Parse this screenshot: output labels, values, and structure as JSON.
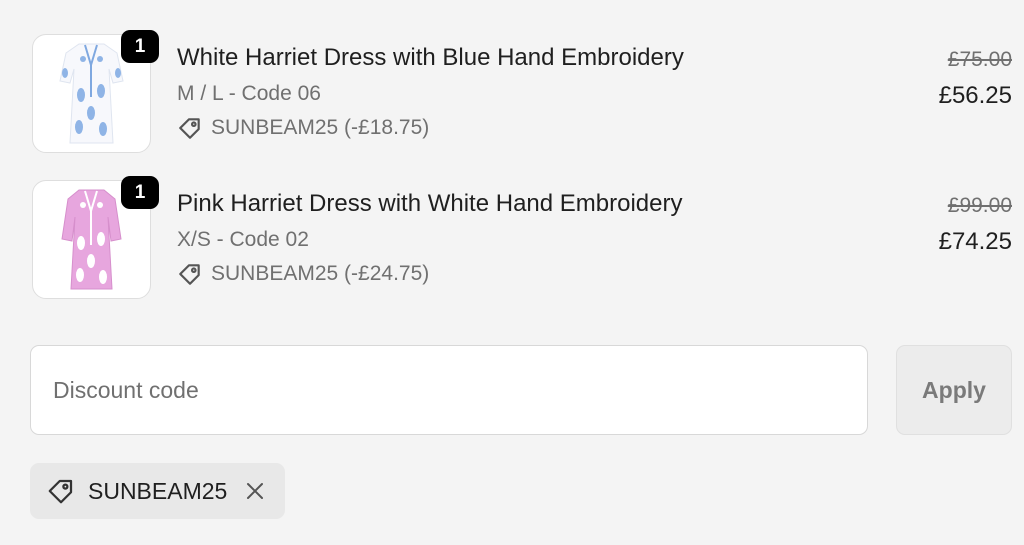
{
  "line_items": [
    {
      "quantity": "1",
      "title": "White Harriet Dress with Blue Hand Embroidery",
      "variant": "M / L - Code 06",
      "discount": "SUNBEAM25 (-£18.75)",
      "price_original": "£75.00",
      "price_final": "£56.25",
      "image": {
        "description_icon": "dress-thumbnail",
        "dress_color": "#f7f8fc",
        "embroidery_color": "#8fb4e6"
      }
    },
    {
      "quantity": "1",
      "title": "Pink Harriet Dress with White Hand Embroidery",
      "variant": "X/S - Code 02",
      "discount": "SUNBEAM25 (-£24.75)",
      "price_original": "£99.00",
      "price_final": "£74.25",
      "image": {
        "description_icon": "dress-thumbnail",
        "dress_color": "#e7a6de",
        "embroidery_color": "#ffffff"
      }
    }
  ],
  "discount_form": {
    "placeholder": "Discount code",
    "value": "",
    "apply_label": "Apply"
  },
  "applied_discount": {
    "code": "SUNBEAM25",
    "icons": [
      "tag-icon",
      "close-icon"
    ]
  },
  "colors": {
    "background": "#f4f4f4",
    "badge": "#000000",
    "muted_text": "#707070",
    "chip_background": "#e8e8e8"
  }
}
